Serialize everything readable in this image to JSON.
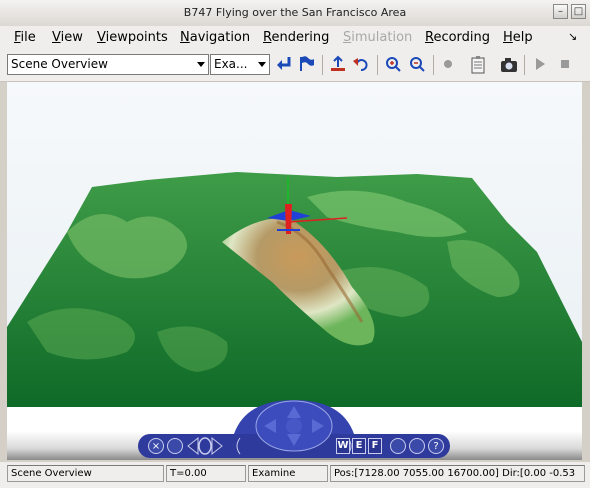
{
  "window": {
    "title": "B747 Flying over the San Francisco Area",
    "minimize_glyph": "–",
    "maximize_glyph": "□"
  },
  "menubar": {
    "items": [
      {
        "label": "File",
        "enabled": true
      },
      {
        "label": "View",
        "enabled": true
      },
      {
        "label": "Viewpoints",
        "enabled": true
      },
      {
        "label": "Navigation",
        "enabled": true
      },
      {
        "label": "Rendering",
        "enabled": true
      },
      {
        "label": "Simulation",
        "enabled": false
      },
      {
        "label": "Recording",
        "enabled": true
      },
      {
        "label": "Help",
        "enabled": true
      }
    ],
    "help_arrow": "↘"
  },
  "toolbar": {
    "viewpoint_select": "Scene Overview",
    "navmode_select": "Exa...",
    "icons": [
      "return-icon",
      "flag-icon",
      "pick-icon",
      "undo-icon",
      "zoom-in-icon",
      "zoom-out-icon",
      "record-icon",
      "notes-icon",
      "camera-icon",
      "play-icon",
      "stop-icon"
    ]
  },
  "dashboard": {
    "close": "×",
    "buttons": [
      "W",
      "E",
      "F"
    ],
    "help": "?"
  },
  "status": {
    "viewpoint": "Scene Overview",
    "time": "T=0.00",
    "mode": "Examine",
    "position": "Pos:[7128.00 7055.00 16700.00] Dir:[0.00 -0.53"
  },
  "colors": {
    "terrain_green": "#2e8b3a",
    "terrain_dark": "#0f6a26",
    "peak_brown": "#a87a3e",
    "dashboard_blue": "#3241a4",
    "toolbar_icon_blue": "#1c49b8"
  }
}
